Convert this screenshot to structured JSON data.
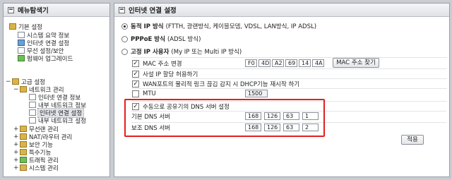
{
  "left_panel": {
    "title": "메뉴탐색기",
    "items": [
      {
        "label": "기본 설정"
      },
      {
        "label": "시스템 요약 정보"
      },
      {
        "label": "인터넷 연결 설정"
      },
      {
        "label": "무선 설정/보안"
      },
      {
        "label": "펌웨어 업그레이드"
      },
      {
        "label": "고급 설정"
      },
      {
        "label": "네트워크 관리"
      },
      {
        "label": "인터넷 연결 정보"
      },
      {
        "label": "내부 네트워크 정보"
      },
      {
        "label": "인터넷 연결 설정"
      },
      {
        "label": "내부 네트워크 설정"
      },
      {
        "label": "무선랜 관리"
      },
      {
        "label": "NAT/라우터 관리"
      },
      {
        "label": "보안 기능"
      },
      {
        "label": "특수기능"
      },
      {
        "label": "트래픽 관리"
      },
      {
        "label": "시스템 관리"
      }
    ]
  },
  "right_panel": {
    "title": "인터넷 연결 설정",
    "options": [
      {
        "bold": "동적 IP 방식",
        "desc": "(FTTH, 광랜방식, 케이블모뎀, VDSL, LAN방식, IP ADSL)",
        "selected": true
      },
      {
        "bold": "PPPoE 방식",
        "desc": "(ADSL 방식)",
        "selected": false
      },
      {
        "bold": "고정 IP 사용자",
        "desc": "(My IP 또는 Multi IP 방식)",
        "selected": false
      }
    ],
    "mac": {
      "label": "MAC 주소 변경",
      "octets": [
        "F0",
        "4D",
        "A2",
        "69",
        "14",
        "4A"
      ],
      "find_button": "MAC 주소 찾기"
    },
    "private_ip_label": "사설 IP 할당 허용하기",
    "wan_dhcp_label": "WAN포트의 물리적 링크 끊김 감지 시 DHCP기능 재시작 하기",
    "mtu": {
      "label": "MTU",
      "value": "1500"
    },
    "dns": {
      "manual_label": "수동으로 공유기의 DNS 서버 설정",
      "primary_label": "기본 DNS 서버",
      "primary": [
        "168",
        "126",
        "63",
        "1"
      ],
      "secondary_label": "보조 DNS 서버",
      "secondary": [
        "168",
        "126",
        "63",
        "2"
      ]
    },
    "apply_button": "적용",
    "highlight_color": "#e0201e"
  }
}
